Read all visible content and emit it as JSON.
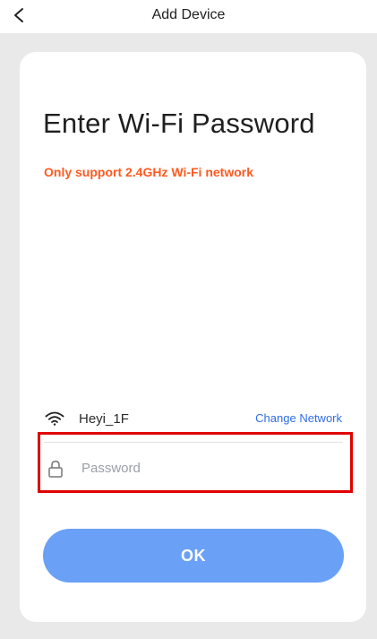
{
  "header": {
    "title": "Add Device",
    "back_icon": "chevron-left-icon"
  },
  "main": {
    "title": "Enter Wi-Fi Password",
    "notice": "Only support 2.4GHz Wi-Fi network",
    "notice_color": "#ff5a1f"
  },
  "network": {
    "icon": "wifi-icon",
    "name": "Heyi_1F",
    "change_label": "Change Network",
    "link_color": "#2f6de6"
  },
  "password": {
    "icon": "lock-icon",
    "value": "",
    "placeholder": "Password",
    "highlight_color": "#e00000"
  },
  "submit": {
    "label": "OK",
    "color": "#6aa1f6"
  }
}
